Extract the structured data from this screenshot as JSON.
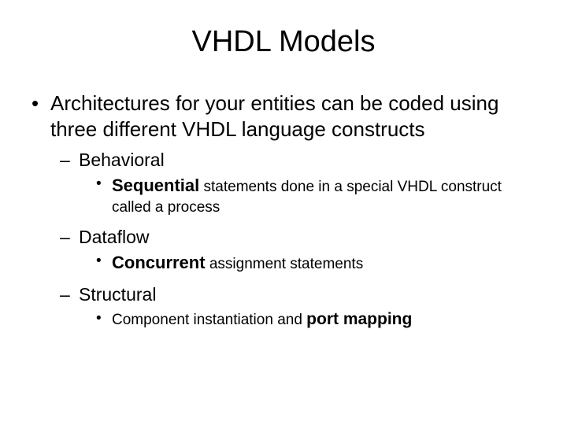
{
  "title": "VHDL Models",
  "b1": "Architectures for your entities can be coded using three different VHDL language constructs",
  "a": {
    "name": "Behavioral",
    "lead": "Sequential",
    "rest": " statements done in a special VHDL construct called a process"
  },
  "b": {
    "name": "Dataflow",
    "lead": "Concurrent",
    "rest": " assignment statements"
  },
  "c": {
    "name": "Structural",
    "pre": "Component instantiation and ",
    "tail": "port mapping"
  }
}
